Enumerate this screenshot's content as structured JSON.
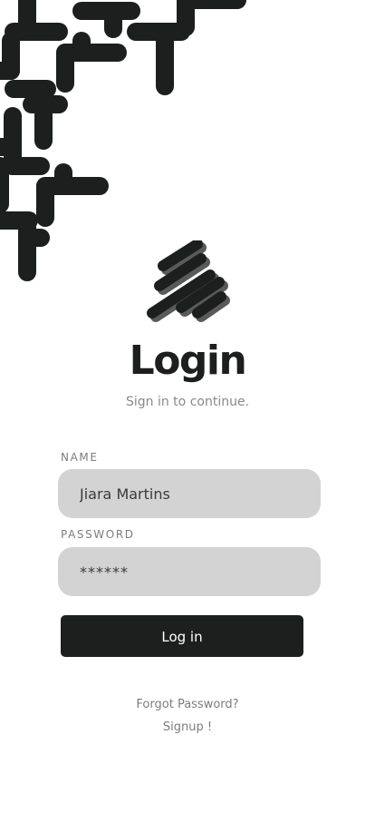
{
  "icons": {
    "background_pattern": "scattered-tee-pattern",
    "logo": "diagonal-stripes-logo"
  },
  "colors": {
    "primary": "#1d1f1f",
    "field_background": "#d3d3d3",
    "muted_text": "#8a8a8a",
    "background": "#ffffff"
  },
  "header": {
    "title": "Login",
    "subtitle": "Sign in to continue."
  },
  "form": {
    "name_label": "NAME",
    "name_value": "Jiara Martins",
    "password_label": "PASSWORD",
    "password_value": "******",
    "submit_label": "Log in"
  },
  "links": {
    "forgot_password": "Forgot Password?",
    "signup": "Signup !"
  }
}
